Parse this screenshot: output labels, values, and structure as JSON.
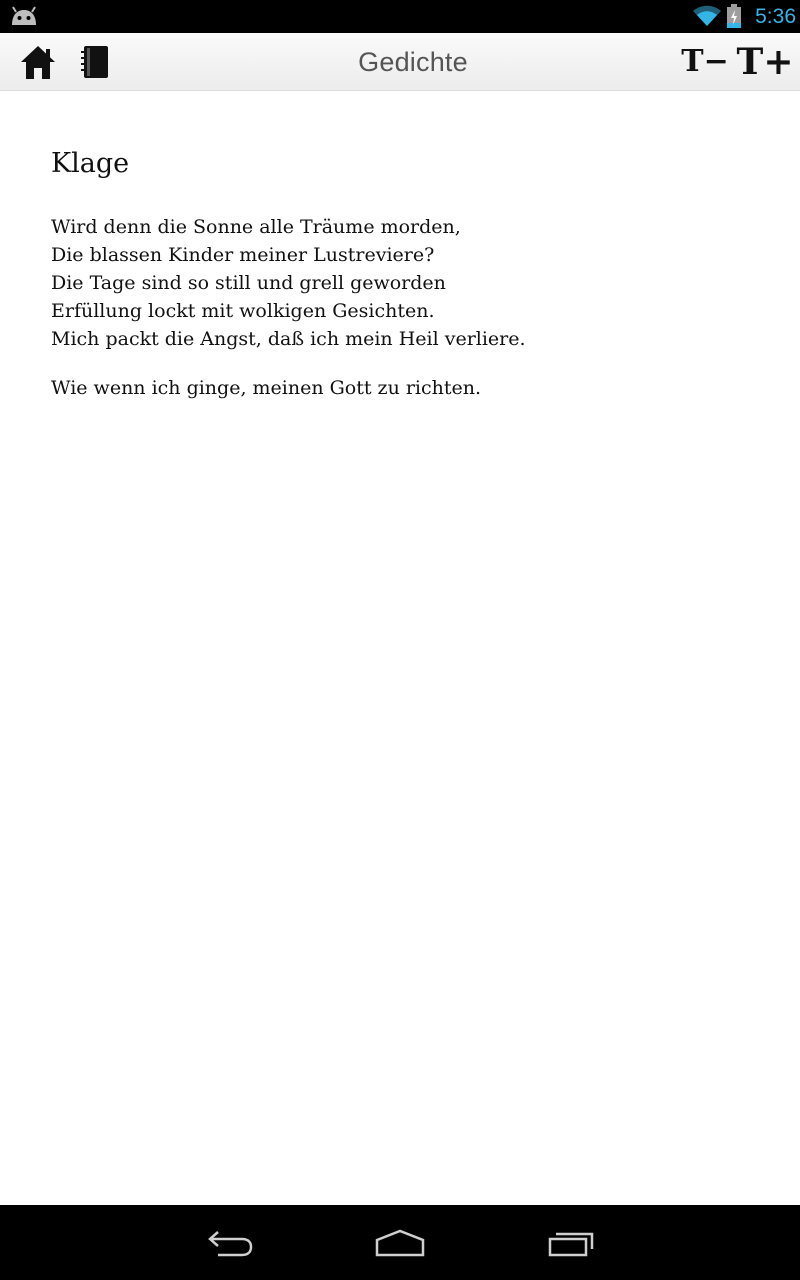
{
  "status_bar": {
    "time": "5:36",
    "icons": [
      "android-notification-icon",
      "wifi-icon",
      "battery-charging-icon"
    ],
    "accent_color": "#33b5e5"
  },
  "action_bar": {
    "title": "Gedichte",
    "buttons": [
      "home-icon",
      "notebook-icon",
      "decrease-text-size",
      "increase-text-size"
    ],
    "decrease_label": "T−",
    "increase_label": "T+"
  },
  "poem": {
    "title": "Klage",
    "stanzas": [
      [
        "Wird denn die Sonne alle Träume morden,",
        "Die blassen Kinder meiner Lustreviere?",
        "Die Tage sind so still und grell geworden",
        "Erfüllung lockt mit wolkigen Gesichten.",
        "Mich packt die Angst, daß ich mein Heil verliere."
      ],
      [
        "Wie wenn ich ginge, meinen Gott zu richten."
      ]
    ]
  },
  "nav_bar": {
    "buttons": [
      "back-icon",
      "home-outline-icon",
      "recent-apps-icon"
    ]
  }
}
